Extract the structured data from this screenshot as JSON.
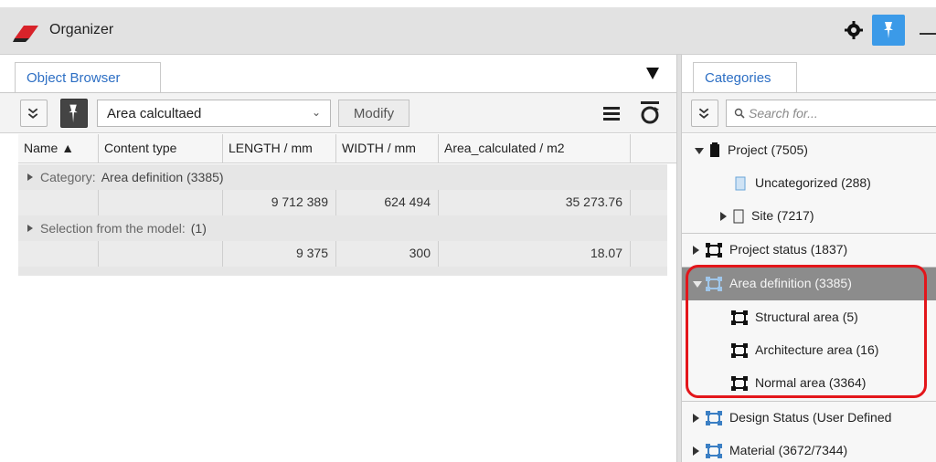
{
  "window": {
    "title": "Organizer",
    "accent": "#3b9ae8",
    "highlight_color": "#e3161b"
  },
  "left_panel": {
    "tab_label": "Object Browser",
    "toolbar": {
      "selected_view": "Area calcultaed",
      "modify_label": "Modify"
    },
    "columns": [
      "Name ▲",
      "Content type",
      "LENGTH / mm",
      "WIDTH / mm",
      "Area_calculated / m2"
    ],
    "groups": [
      {
        "label": "Category:",
        "value": "Area definition (3385)",
        "row": [
          "",
          "",
          "9 712 389",
          "624 494",
          "35 273.76"
        ]
      },
      {
        "label": "Selection from the model:",
        "value": "(1)",
        "row": [
          "",
          "",
          "9 375",
          "300",
          "18.07"
        ]
      }
    ]
  },
  "right_panel": {
    "tab_label": "Categories",
    "search_placeholder": "Search for...",
    "tree": [
      {
        "label": "Project (7505)",
        "icon": "project-icon",
        "expanded": true
      },
      {
        "label": "Uncategorized (288)",
        "icon": "folder-icon"
      },
      {
        "label": "Site (7217)",
        "icon": "folder-icon",
        "expanded": false
      },
      {
        "label": "Project status (1837)",
        "icon": "category-icon",
        "expanded": false
      },
      {
        "label": "Area definition (3385)",
        "icon": "category-icon",
        "expanded": true,
        "selected": true
      },
      {
        "label": "Structural area (5)",
        "icon": "category-icon"
      },
      {
        "label": "Architecture area (16)",
        "icon": "category-icon"
      },
      {
        "label": "Normal area (3364)",
        "icon": "category-icon"
      },
      {
        "label": "Design Status (User Defined",
        "icon": "category-blue-icon",
        "expanded": false
      },
      {
        "label": "Material (3672/7344)",
        "icon": "category-blue-icon",
        "expanded": false
      }
    ]
  }
}
